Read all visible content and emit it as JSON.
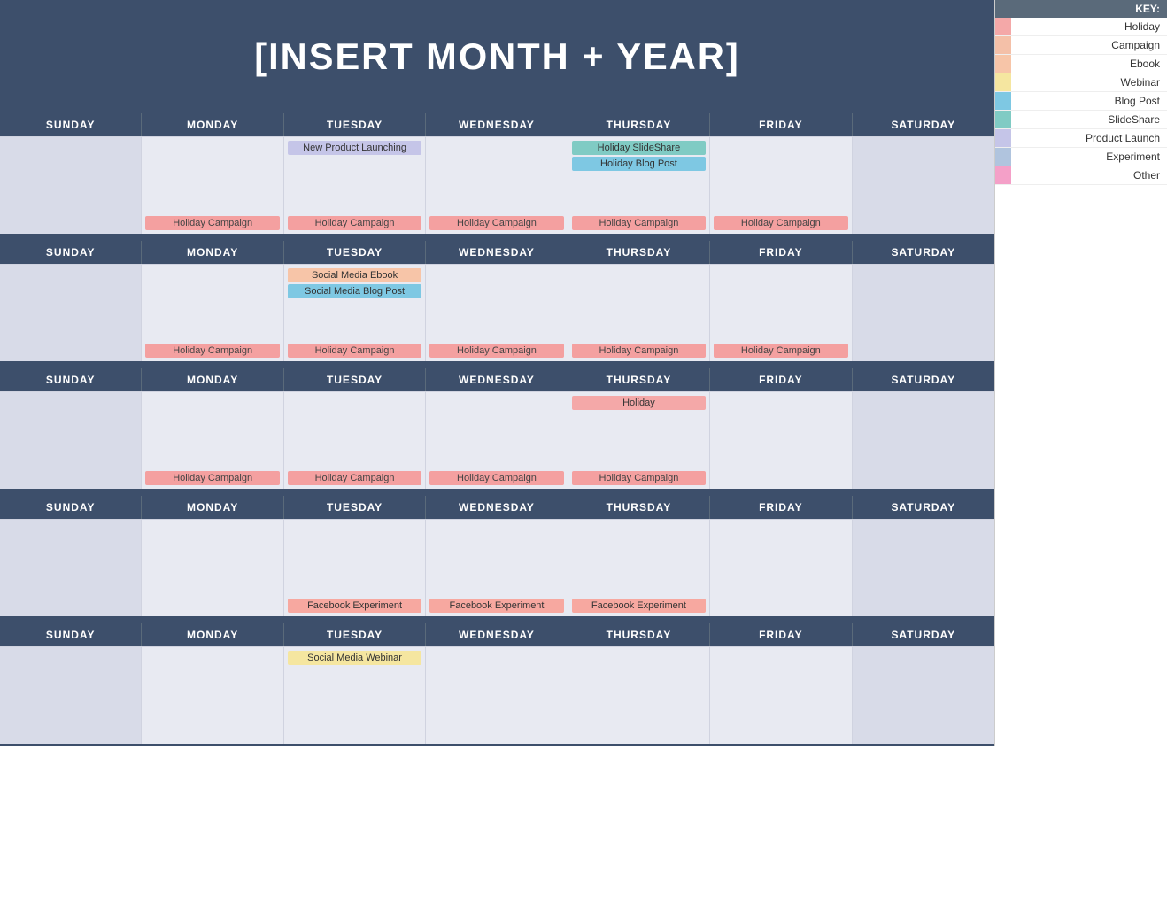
{
  "title": "[INSERT MONTH + YEAR]",
  "key": {
    "label": "KEY:",
    "items": [
      {
        "name": "Holiday",
        "color": "#f4a8a8"
      },
      {
        "name": "Campaign",
        "color": "#f4c0a8"
      },
      {
        "name": "Ebook",
        "color": "#f7c5a8"
      },
      {
        "name": "Webinar",
        "color": "#f5e6a0"
      },
      {
        "name": "Blog Post",
        "color": "#7ec8e3"
      },
      {
        "name": "SlideShare",
        "color": "#80cbc4"
      },
      {
        "name": "Product Launch",
        "color": "#c5c5e8"
      },
      {
        "name": "Experiment",
        "color": "#b0c4de"
      },
      {
        "name": "Other",
        "color": "#f4a0c8"
      }
    ]
  },
  "days": [
    "SUNDAY",
    "MONDAY",
    "TUESDAY",
    "WEDNESDAY",
    "THURSDAY",
    "FRIDAY",
    "SATURDAY"
  ],
  "weeks": [
    {
      "cells": [
        {
          "events": [],
          "bottom": ""
        },
        {
          "events": [],
          "bottom": "Holiday Campaign"
        },
        {
          "events": [
            "New Product Launching"
          ],
          "bottom": "Holiday Campaign"
        },
        {
          "events": [],
          "bottom": "Holiday Campaign"
        },
        {
          "events": [
            "Holiday SlideShare",
            "Holiday Blog Post"
          ],
          "bottom": "Holiday Campaign"
        },
        {
          "events": [],
          "bottom": "Holiday Campaign"
        },
        {
          "events": [],
          "bottom": ""
        }
      ]
    },
    {
      "cells": [
        {
          "events": [],
          "bottom": ""
        },
        {
          "events": [],
          "bottom": "Holiday Campaign"
        },
        {
          "events": [
            "Social Media Ebook",
            "Social Media Blog Post"
          ],
          "bottom": "Holiday Campaign"
        },
        {
          "events": [],
          "bottom": "Holiday Campaign"
        },
        {
          "events": [],
          "bottom": "Holiday Campaign"
        },
        {
          "events": [],
          "bottom": "Holiday Campaign"
        },
        {
          "events": [],
          "bottom": ""
        }
      ]
    },
    {
      "cells": [
        {
          "events": [],
          "bottom": ""
        },
        {
          "events": [],
          "bottom": "Holiday Campaign"
        },
        {
          "events": [],
          "bottom": "Holiday Campaign"
        },
        {
          "events": [],
          "bottom": "Holiday Campaign"
        },
        {
          "events": [
            "Holiday"
          ],
          "bottom": "Holiday Campaign"
        },
        {
          "events": [],
          "bottom": ""
        },
        {
          "events": [],
          "bottom": ""
        }
      ]
    },
    {
      "cells": [
        {
          "events": [],
          "bottom": ""
        },
        {
          "events": [],
          "bottom": ""
        },
        {
          "events": [],
          "bottom": "Facebook Experiment"
        },
        {
          "events": [],
          "bottom": "Facebook Experiment"
        },
        {
          "events": [],
          "bottom": "Facebook Experiment"
        },
        {
          "events": [],
          "bottom": ""
        },
        {
          "events": [],
          "bottom": ""
        }
      ]
    },
    {
      "cells": [
        {
          "events": [],
          "bottom": ""
        },
        {
          "events": [],
          "bottom": ""
        },
        {
          "events": [
            "Social Media Webinar"
          ],
          "bottom": ""
        },
        {
          "events": [],
          "bottom": ""
        },
        {
          "events": [],
          "bottom": ""
        },
        {
          "events": [],
          "bottom": ""
        },
        {
          "events": [],
          "bottom": ""
        }
      ]
    }
  ]
}
